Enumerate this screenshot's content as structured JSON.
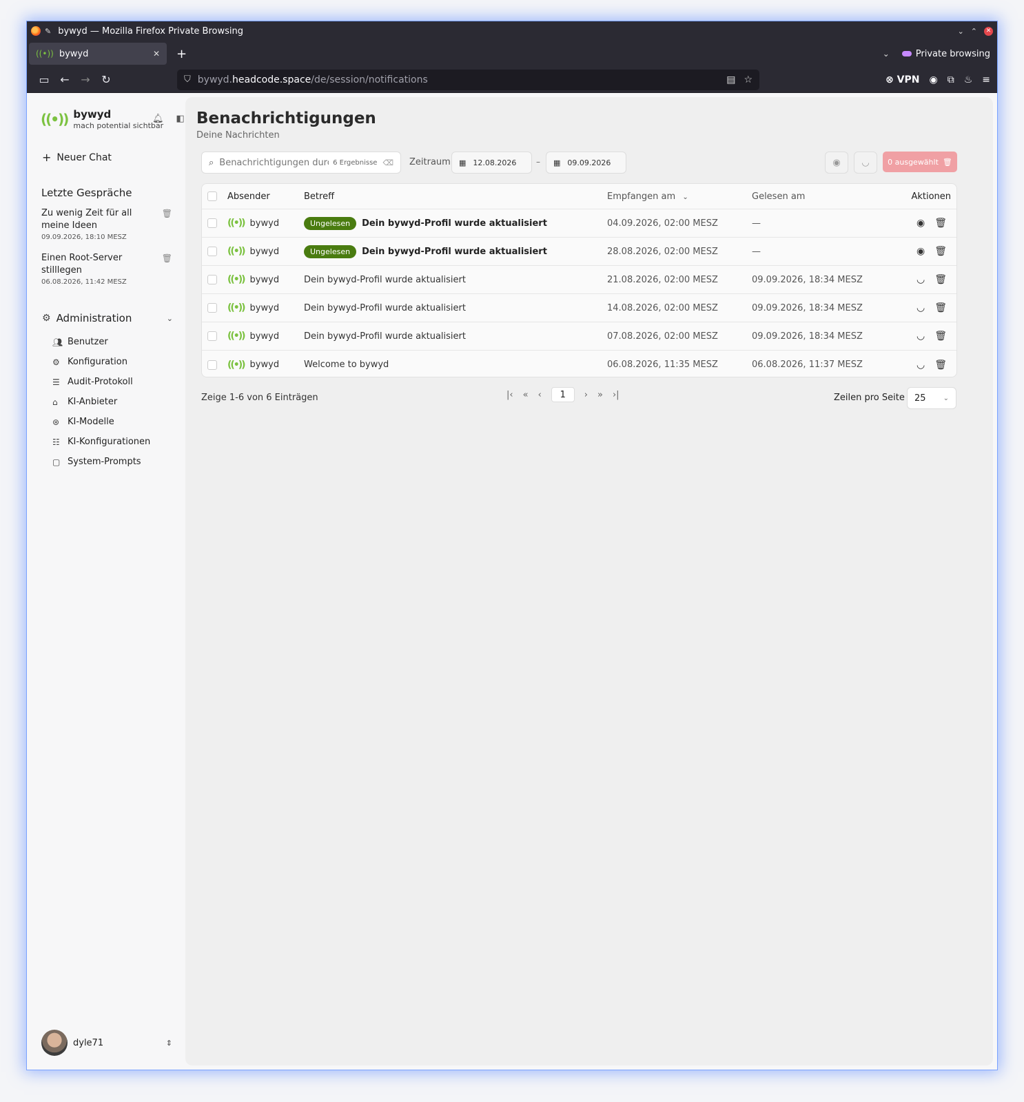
{
  "browser": {
    "window_title": "bywyd — Mozilla Firefox Private Browsing",
    "tab_label": "bywyd",
    "private_label": "Private browsing",
    "url_prefix": "bywyd.",
    "url_host": "headcode.space",
    "url_path": "/de/session/notifications",
    "vpn_label": "VPN"
  },
  "sidebar": {
    "brand_name": "bywyd",
    "brand_tagline": "mach potential sichtbar",
    "new_chat": "Neuer Chat",
    "recent_title": "Letzte Gespräche",
    "conversations": [
      {
        "title": "Zu wenig Zeit für all meine Ideen",
        "date": "09.09.2026, 18:10 MESZ"
      },
      {
        "title": "Einen Root-Server stilllegen",
        "date": "06.08.2026, 11:42 MESZ"
      }
    ],
    "admin_label": "Administration",
    "admin_items": [
      {
        "label": "Benutzer",
        "icon": "users-icon"
      },
      {
        "label": "Konfiguration",
        "icon": "gear-icon"
      },
      {
        "label": "Audit-Protokoll",
        "icon": "list-icon"
      },
      {
        "label": "KI-Anbieter",
        "icon": "bot-icon"
      },
      {
        "label": "KI-Modelle",
        "icon": "brain-icon"
      },
      {
        "label": "KI-Konfigurationen",
        "icon": "sliders-icon"
      },
      {
        "label": "System-Prompts",
        "icon": "message-icon"
      }
    ],
    "user_name": "dyle71"
  },
  "main": {
    "title": "Benachrichtigungen",
    "subtitle": "Deine Nachrichten",
    "search_placeholder": "Benachrichtigungen durc",
    "search_count": "6 Ergebnisse",
    "zeitraum_label": "Zeitraum",
    "date_from": "12.08.2026",
    "date_to": "09.09.2026",
    "delete_selected": "0 ausgewählt",
    "columns": {
      "sender": "Absender",
      "subject": "Betreff",
      "received": "Empfangen am",
      "read": "Gelesen am",
      "actions": "Aktionen"
    },
    "unread_badge": "Ungelesen",
    "rows": [
      {
        "sender": "bywyd",
        "unread": true,
        "subject": "Dein bywyd-Profil wurde aktualisiert",
        "received": "04.09.2026, 02:00 MESZ",
        "read": "—"
      },
      {
        "sender": "bywyd",
        "unread": true,
        "subject": "Dein bywyd-Profil wurde aktualisiert",
        "received": "28.08.2026, 02:00 MESZ",
        "read": "—"
      },
      {
        "sender": "bywyd",
        "unread": false,
        "subject": "Dein bywyd-Profil wurde aktualisiert",
        "received": "21.08.2026, 02:00 MESZ",
        "read": "09.09.2026, 18:34 MESZ"
      },
      {
        "sender": "bywyd",
        "unread": false,
        "subject": "Dein bywyd-Profil wurde aktualisiert",
        "received": "14.08.2026, 02:00 MESZ",
        "read": "09.09.2026, 18:34 MESZ"
      },
      {
        "sender": "bywyd",
        "unread": false,
        "subject": "Dein bywyd-Profil wurde aktualisiert",
        "received": "07.08.2026, 02:00 MESZ",
        "read": "09.09.2026, 18:34 MESZ"
      },
      {
        "sender": "bywyd",
        "unread": false,
        "subject": "Welcome to bywyd",
        "received": "06.08.2026, 11:35 MESZ",
        "read": "06.08.2026, 11:37 MESZ"
      }
    ],
    "footer_info": "Zeige 1-6 von 6 Einträgen",
    "current_page": "1",
    "rows_per_page_label": "Zeilen pro Seite",
    "rows_per_page_value": "25"
  },
  "colors": {
    "accent": "#7cc241",
    "badge": "#4a7c10",
    "danger_soft": "#f0a0a4"
  }
}
